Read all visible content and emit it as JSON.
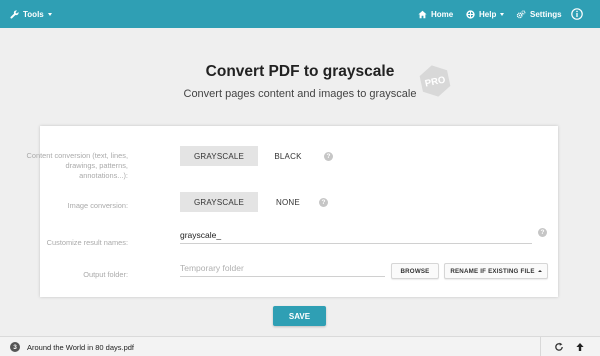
{
  "topbar": {
    "tools_label": "Tools",
    "home_label": "Home",
    "help_label": "Help",
    "settings_label": "Settings"
  },
  "header": {
    "title": "Convert PDF to grayscale",
    "subtitle": "Convert pages content and images to grayscale",
    "badge": "PRO"
  },
  "form": {
    "content_conversion": {
      "label": "Content conversion (text, lines, drawings, patterns, annotations...):",
      "options": [
        "GRAYSCALE",
        "BLACK"
      ],
      "selected": "GRAYSCALE"
    },
    "image_conversion": {
      "label": "Image conversion:",
      "options": [
        "GRAYSCALE",
        "NONE"
      ],
      "selected": "GRAYSCALE"
    },
    "result_names": {
      "label": "Customize result names:",
      "value": "grayscale_"
    },
    "output_folder": {
      "label": "Output folder:",
      "placeholder": "Temporary folder",
      "browse_label": "BROWSE",
      "rename_label": "RENAME IF EXISTING FILE"
    },
    "help_glyph": "?"
  },
  "save_label": "SAVE",
  "footer": {
    "file_count": "3",
    "file_name": "Around the World in 80 days.pdf"
  },
  "colors": {
    "accent": "#2f9fb4",
    "background": "#efefef",
    "selected_option": "#e4e4e4"
  },
  "icons": [
    "wrench-icon",
    "home-icon",
    "lifebuoy-icon",
    "cogs-icon",
    "info-icon",
    "question-icon",
    "refresh-icon",
    "upload-icon"
  ]
}
